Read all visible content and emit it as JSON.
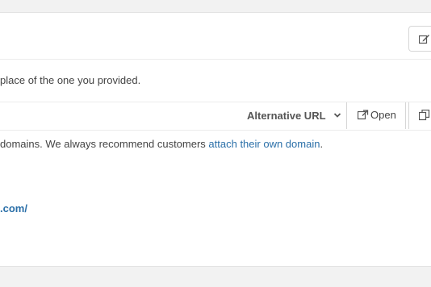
{
  "notice": {
    "text": "place of the one you provided."
  },
  "url_bar": {
    "alternative_url_label": "Alternative URL",
    "open_label": "Open"
  },
  "domains_note": {
    "text_before": "domains. We always recommend customers ",
    "link_text": "attach their own domain",
    "text_after": "."
  },
  "site_link": {
    "text": ".com/"
  },
  "icons": {
    "edit": "edit-icon",
    "chevron": "chevron-down-icon",
    "external_link": "external-link-icon",
    "copy": "copy-icon"
  },
  "colors": {
    "link": "#2a6fa8",
    "background": "#f2f2f2",
    "panel": "#ffffff"
  }
}
